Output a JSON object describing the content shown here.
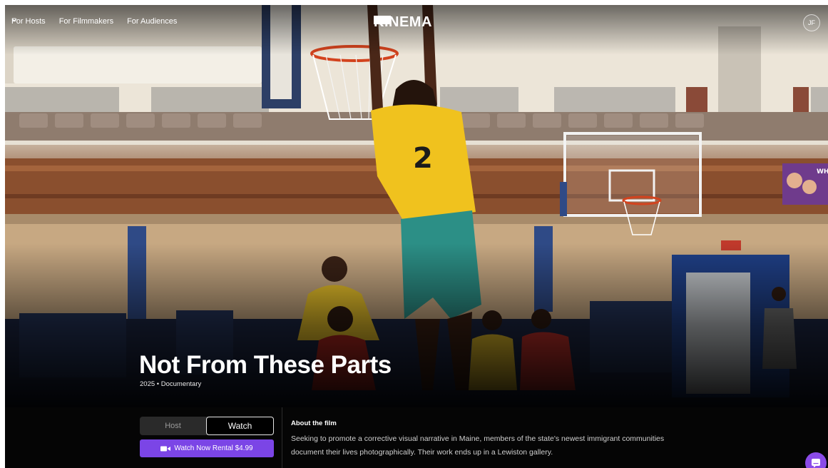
{
  "nav": {
    "links": [
      {
        "label": "For Hosts"
      },
      {
        "label": "For Filmmakers"
      },
      {
        "label": "For Audiences"
      }
    ],
    "logo_text": "KINEMA",
    "avatar_initials": "JF"
  },
  "hero": {
    "title": "Not From These Parts",
    "meta": "2025 • Documentary",
    "scene": {
      "jersey_number": "2",
      "poster_text": "WHY TOD"
    }
  },
  "panel": {
    "toggle": {
      "options": [
        {
          "label": "Host",
          "active": false
        },
        {
          "label": "Watch",
          "active": true
        }
      ]
    },
    "watch_button": {
      "label": "Watch Now Rental $4.99"
    },
    "about": {
      "heading": "About the film",
      "description": "Seeking to promote a corrective visual narrative in Maine, members of the state's newest immigrant communities document their lives photographically. Their work ends up in a Lewiston gallery."
    }
  },
  "colors": {
    "accent": "#7b45e6",
    "chat": "#8b4be8",
    "panel_bg": "#050505"
  },
  "icons": {
    "nav_chevron": "chevron-down-icon",
    "logo": "kinema-logo-icon",
    "watch": "video-camera-icon",
    "chat": "chat-icon"
  }
}
